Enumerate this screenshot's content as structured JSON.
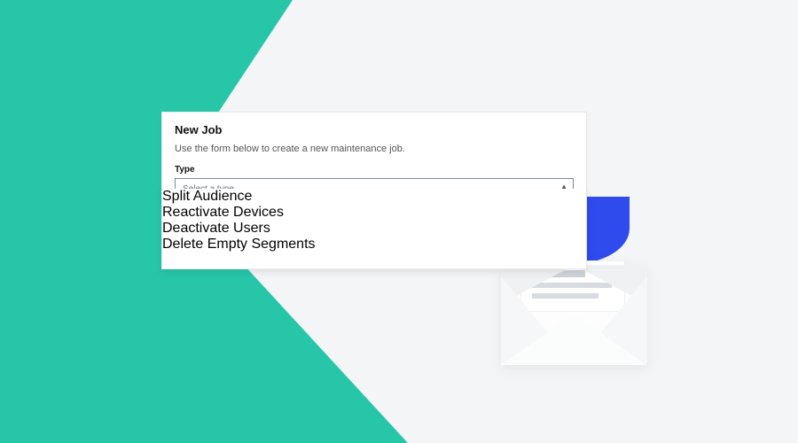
{
  "colors": {
    "teal": "#27c6a9",
    "blue": "#2f4aed",
    "highlight": "#6c8af6"
  },
  "panel": {
    "title": "New Job",
    "description": "Use the form below to create a new maintenance job.",
    "type_label": "Type",
    "select_placeholder": "Select a type"
  },
  "dropdown": {
    "options": [
      {
        "label": "Split Audience",
        "highlighted": false
      },
      {
        "label": "Reactivate Devices",
        "highlighted": false
      },
      {
        "label": "Deactivate Users",
        "highlighted": true
      },
      {
        "label": "Delete Empty Segments",
        "highlighted": false
      }
    ]
  }
}
